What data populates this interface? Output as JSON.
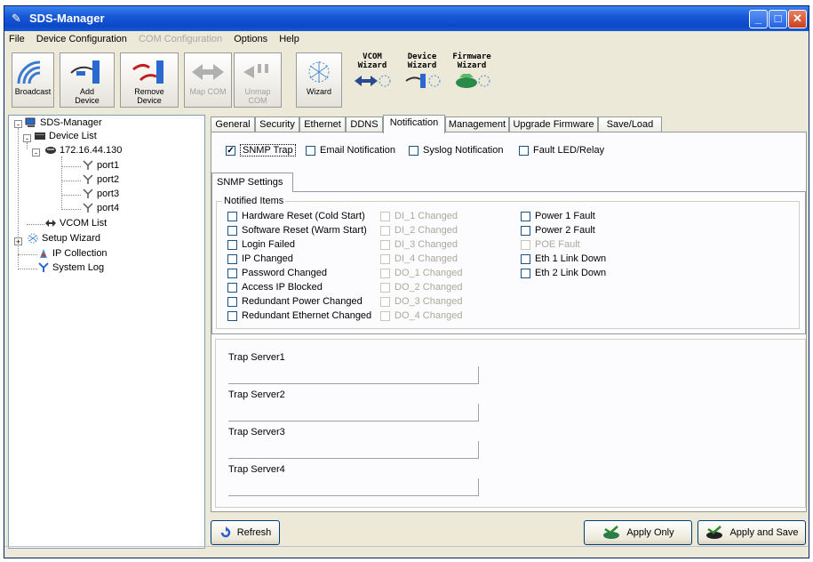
{
  "window": {
    "title": "SDS-Manager"
  },
  "menu": [
    {
      "label": "File",
      "enabled": true
    },
    {
      "label": "Device Configuration",
      "enabled": true
    },
    {
      "label": "COM Configuration",
      "enabled": false
    },
    {
      "label": "Options",
      "enabled": true
    },
    {
      "label": "Help",
      "enabled": true
    }
  ],
  "toolbar": {
    "broadcast": "Broadcast",
    "add_device_1": "Add",
    "add_device_2": "Device",
    "remove_device_1": "Remove",
    "remove_device_2": "Device",
    "map_com": "Map COM",
    "unmap_com_1": "Unmap",
    "unmap_com_2": "COM",
    "wizard": "Wizard",
    "vcom_wizard_1": "VCOM",
    "vcom_wizard_2": "Wizard",
    "device_wizard_1": "Device",
    "device_wizard_2": "Wizard",
    "firmware_wizard_1": "Firmware",
    "firmware_wizard_2": "Wizard"
  },
  "tree": {
    "root": "SDS-Manager",
    "device_list": "Device List",
    "device_ip": "172.16.44.130",
    "ports": [
      "port1",
      "port2",
      "port3",
      "port4"
    ],
    "vcom_list": "VCOM List",
    "setup_wizard": "Setup Wizard",
    "ip_collection": "IP Collection",
    "system_log": "System Log"
  },
  "tabs": [
    "General",
    "Security",
    "Ethernet",
    "DDNS",
    "Notification",
    "Management",
    "Upgrade Firmware",
    "Save/Load"
  ],
  "active_tab": "Notification",
  "notification_types": [
    {
      "label": "SNMP Trap",
      "checked": true
    },
    {
      "label": "Email Notification",
      "checked": false
    },
    {
      "label": "Syslog Notification",
      "checked": false
    },
    {
      "label": "Fault LED/Relay",
      "checked": false
    }
  ],
  "subtab": "SNMP Settings",
  "notified_items_label": "Notified Items",
  "notified_col1": [
    "Hardware Reset (Cold Start)",
    "Software Reset (Warm Start)",
    "Login Failed",
    "IP Changed",
    "Password Changed",
    "Access IP Blocked",
    "Redundant Power Changed",
    "Redundant Ethernet Changed"
  ],
  "notified_col2": [
    "DI_1 Changed",
    "DI_2 Changed",
    "DI_3 Changed",
    "DI_4 Changed",
    "DO_1 Changed",
    "DO_2 Changed",
    "DO_3 Changed",
    "DO_4 Changed"
  ],
  "notified_col3": [
    {
      "label": "Power 1 Fault",
      "enabled": true
    },
    {
      "label": "Power 2 Fault",
      "enabled": true
    },
    {
      "label": "POE Fault",
      "enabled": false
    },
    {
      "label": "Eth 1 Link Down",
      "enabled": true
    },
    {
      "label": "Eth 2 Link Down",
      "enabled": true
    }
  ],
  "trap_servers": [
    {
      "label": "Trap Server1",
      "value": ""
    },
    {
      "label": "Trap Server2",
      "value": ""
    },
    {
      "label": "Trap Server3",
      "value": ""
    },
    {
      "label": "Trap Server4",
      "value": ""
    }
  ],
  "buttons": {
    "refresh": "Refresh",
    "apply_only": "Apply Only",
    "apply_and_save": "Apply and Save"
  },
  "colors": {
    "titlebar": "#0a48c8",
    "window_bg": "#ece9d8",
    "panel_bg": "#fcfcfe"
  }
}
